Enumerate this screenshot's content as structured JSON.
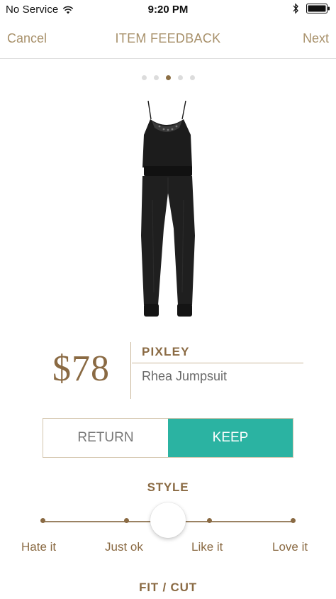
{
  "status_bar": {
    "carrier": "No Service",
    "time": "9:20 PM",
    "wifi_icon": "wifi-icon",
    "bluetooth_icon": "bluetooth-icon",
    "battery_icon": "battery-icon"
  },
  "nav": {
    "cancel_label": "Cancel",
    "title": "ITEM FEEDBACK",
    "next_label": "Next"
  },
  "pager": {
    "total": 5,
    "active_index": 2
  },
  "product": {
    "image_icon": "jumpsuit-image",
    "price": "$78",
    "brand": "PIXLEY",
    "name": "Rhea Jumpsuit"
  },
  "decision": {
    "return_label": "RETURN",
    "keep_label": "KEEP",
    "selected": "KEEP"
  },
  "style_rating": {
    "title": "STYLE",
    "options": [
      "Hate it",
      "Just ok",
      "Like it",
      "Love it"
    ],
    "value": null
  },
  "fit": {
    "title": "FIT / CUT"
  },
  "colors": {
    "accent": "#a8916b",
    "brown": "#8a6a43",
    "keep_teal": "#2bb3a2"
  }
}
